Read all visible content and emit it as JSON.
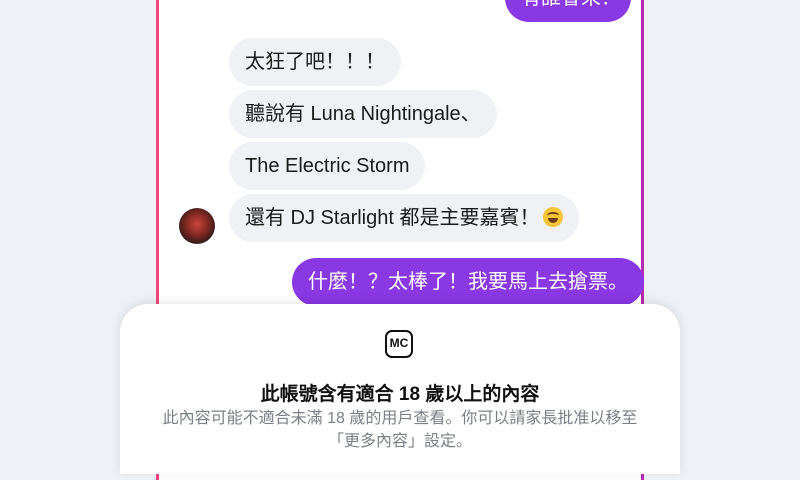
{
  "chat": {
    "outgoing_top_partial": "有誰會來？",
    "incoming": [
      "太狂了吧！！！",
      "聽說有 Luna Nightingale、",
      "The Electric Storm",
      "還有 DJ Starlight 都是主要嘉賓！"
    ],
    "incoming_emoji": "star-struck-emoji",
    "outgoing": "什麼！？太棒了！我要馬上去搶票。"
  },
  "notice": {
    "badge": "MC",
    "title": "此帳號含有適合 18 歲以上的內容",
    "description": "此內容可能不適合未滿 18 歲的用戶查看。你可以請家長批准以移至「更多內容」設定。"
  },
  "colors": {
    "outgoing_bubble": "#8a37e4",
    "incoming_bubble": "#eff1f4",
    "frame_left": "#f0477d",
    "frame_right": "#b62bb0"
  }
}
